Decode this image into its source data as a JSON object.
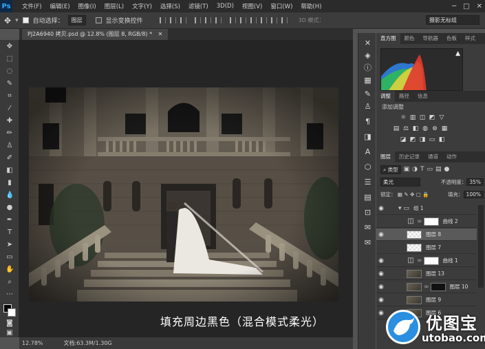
{
  "app": {
    "logo": "Ps"
  },
  "menu": [
    "文件(F)",
    "编辑(E)",
    "图像(I)",
    "图层(L)",
    "文字(Y)",
    "选择(S)",
    "滤镜(T)",
    "3D(D)",
    "视图(V)",
    "窗口(W)",
    "帮助(H)"
  ],
  "options": {
    "auto_select_label": "自动选择：",
    "auto_select_value": "图层",
    "show_transform_label": "显示变换控件",
    "mode_label": "3D 模式：",
    "workspace": "摄影无标组"
  },
  "document": {
    "tab_title": "PJ2A6940 拷贝.psd @ 12.8% (图层 8, RGB/8) *",
    "caption": "填充周边黑色（混合模式柔光）",
    "zoom": "12.78%",
    "doc_size": "文档:63.3M/1.30G"
  },
  "panels": {
    "top_tabs": [
      "直方图",
      "颜色",
      "导航器",
      "色板",
      "样式"
    ],
    "mid_tabs": [
      "调整",
      "路径",
      "信息"
    ],
    "adjust_label": "添加调整",
    "layer_tabs": [
      "图层",
      "历史记录",
      "通道",
      "动作"
    ],
    "filter_kind": "类型",
    "blend_mode": "柔光",
    "opacity_label": "不透明度：",
    "opacity_value": "35%",
    "lock_label": "锁定：",
    "fill_label": "填充：",
    "fill_value": "100%"
  },
  "layers": [
    {
      "name": "组 1",
      "kind": "group",
      "visible": true
    },
    {
      "name": "曲线 2",
      "kind": "curves",
      "visible": false
    },
    {
      "name": "图层 8",
      "kind": "checker",
      "visible": true,
      "selected": true
    },
    {
      "name": "图层 7",
      "kind": "checker",
      "visible": false
    },
    {
      "name": "曲线 1",
      "kind": "curves-mask",
      "visible": true
    },
    {
      "name": "图层 13",
      "kind": "photo",
      "visible": true
    },
    {
      "name": "图层 10",
      "kind": "photo-mask",
      "visible": true
    },
    {
      "name": "图层 9",
      "kind": "photo",
      "visible": true
    },
    {
      "name": "图层 6",
      "kind": "photo",
      "visible": true
    }
  ],
  "watermark": {
    "title": "优图宝",
    "url": "utobao.com"
  }
}
